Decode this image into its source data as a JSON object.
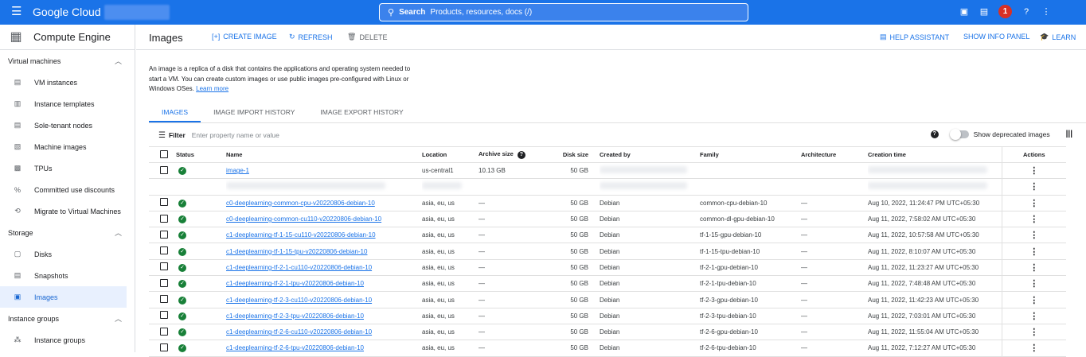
{
  "topbar": {
    "brand": "Google Cloud",
    "search_label": "Search",
    "search_placeholder": "Products, resources, docs (/)",
    "notifications_count": "1"
  },
  "sidebar": {
    "product": "Compute Engine",
    "sections": [
      {
        "title": "Virtual machines",
        "items": [
          "VM instances",
          "Instance templates",
          "Sole-tenant nodes",
          "Machine images",
          "TPUs",
          "Committed use discounts",
          "Migrate to Virtual Machines"
        ]
      },
      {
        "title": "Storage",
        "items": [
          "Disks",
          "Snapshots",
          "Images"
        ]
      },
      {
        "title": "Instance groups",
        "items": [
          "Instance groups"
        ]
      }
    ],
    "active_item": "Images"
  },
  "actionbar": {
    "title": "Images",
    "create": "CREATE IMAGE",
    "refresh": "REFRESH",
    "delete": "DELETE",
    "help_assistant": "HELP ASSISTANT",
    "show_info_panel": "SHOW INFO PANEL",
    "learn": "LEARN"
  },
  "description": {
    "text": "An image is a replica of a disk that contains the applications and operating system needed to start a VM. You can create custom images or use public images pre-configured with Linux or Windows OSes.",
    "link": "Learn more"
  },
  "tabs": [
    "IMAGES",
    "IMAGE IMPORT HISTORY",
    "IMAGE EXPORT HISTORY"
  ],
  "filter": {
    "label": "Filter",
    "placeholder": "Enter property name or value",
    "deprecated_toggle": "Show deprecated images"
  },
  "table": {
    "headers": [
      "Status",
      "Name",
      "Location",
      "Archive size",
      "Disk size",
      "Created by",
      "Family",
      "Architecture",
      "Creation time",
      "Actions"
    ],
    "rows": [
      {
        "name": "image-1",
        "location": "us-central1",
        "archive": "10.13 GB",
        "disk": "50 GB",
        "created_by": "",
        "family": "",
        "arch": "",
        "time": ""
      },
      {
        "name": "c0-deeplearning-common-cpu-v20220806-debian-10",
        "location": "asia, eu, us",
        "archive": "—",
        "disk": "50 GB",
        "created_by": "Debian",
        "family": "common-cpu-debian-10",
        "arch": "—",
        "time": "Aug 10, 2022, 11:24:47 PM UTC+05:30"
      },
      {
        "name": "c0-deeplearning-common-cu110-v20220806-debian-10",
        "location": "asia, eu, us",
        "archive": "—",
        "disk": "50 GB",
        "created_by": "Debian",
        "family": "common-dl-gpu-debian-10",
        "arch": "—",
        "time": "Aug 11, 2022, 7:58:02 AM UTC+05:30"
      },
      {
        "name": "c1-deeplearning-tf-1-15-cu110-v20220806-debian-10",
        "location": "asia, eu, us",
        "archive": "—",
        "disk": "50 GB",
        "created_by": "Debian",
        "family": "tf-1-15-gpu-debian-10",
        "arch": "—",
        "time": "Aug 11, 2022, 10:57:58 AM UTC+05:30"
      },
      {
        "name": "c1-deeplearning-tf-1-15-tpu-v20220806-debian-10",
        "location": "asia, eu, us",
        "archive": "—",
        "disk": "50 GB",
        "created_by": "Debian",
        "family": "tf-1-15-tpu-debian-10",
        "arch": "—",
        "time": "Aug 11, 2022, 8:10:07 AM UTC+05:30"
      },
      {
        "name": "c1-deeplearning-tf-2-1-cu110-v20220806-debian-10",
        "location": "asia, eu, us",
        "archive": "—",
        "disk": "50 GB",
        "created_by": "Debian",
        "family": "tf-2-1-gpu-debian-10",
        "arch": "—",
        "time": "Aug 11, 2022, 11:23:27 AM UTC+05:30"
      },
      {
        "name": "c1-deeplearning-tf-2-1-tpu-v20220806-debian-10",
        "location": "asia, eu, us",
        "archive": "—",
        "disk": "50 GB",
        "created_by": "Debian",
        "family": "tf-2-1-tpu-debian-10",
        "arch": "—",
        "time": "Aug 11, 2022, 7:48:48 AM UTC+05:30"
      },
      {
        "name": "c1-deeplearning-tf-2-3-cu110-v20220806-debian-10",
        "location": "asia, eu, us",
        "archive": "—",
        "disk": "50 GB",
        "created_by": "Debian",
        "family": "tf-2-3-gpu-debian-10",
        "arch": "—",
        "time": "Aug 11, 2022, 11:42:23 AM UTC+05:30"
      },
      {
        "name": "c1-deeplearning-tf-2-3-tpu-v20220806-debian-10",
        "location": "asia, eu, us",
        "archive": "—",
        "disk": "50 GB",
        "created_by": "Debian",
        "family": "tf-2-3-tpu-debian-10",
        "arch": "—",
        "time": "Aug 11, 2022, 7:03:01 AM UTC+05:30"
      },
      {
        "name": "c1-deeplearning-tf-2-6-cu110-v20220806-debian-10",
        "location": "asia, eu, us",
        "archive": "—",
        "disk": "50 GB",
        "created_by": "Debian",
        "family": "tf-2-6-gpu-debian-10",
        "arch": "—",
        "time": "Aug 11, 2022, 11:55:04 AM UTC+05:30"
      },
      {
        "name": "c1-deeplearning-tf-2-6-tpu-v20220806-debian-10",
        "location": "asia, eu, us",
        "archive": "—",
        "disk": "50 GB",
        "created_by": "Debian",
        "family": "tf-2-6-tpu-debian-10",
        "arch": "—",
        "time": "Aug 11, 2022, 7:12:27 AM UTC+05:30"
      }
    ]
  },
  "colors": {
    "brand_blue": "#1a73e8",
    "status_green": "#188038",
    "badge_red": "#d93025"
  }
}
